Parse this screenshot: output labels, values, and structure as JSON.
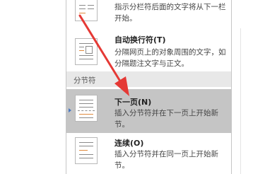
{
  "menu": {
    "items": [
      {
        "title": "",
        "desc": "指示分栏符后面的文字将从下一栏开始。",
        "icon": "column-break-icon"
      },
      {
        "title": "自动换行符(T)",
        "desc": "分隔网页上的对象周围的文字，如分隔题注文字与正文。",
        "icon": "text-wrapping-break-icon"
      },
      {
        "title": "下一页(N)",
        "desc": "插入分节符并在下一页上开始新节。",
        "icon": "next-page-section-break-icon"
      },
      {
        "title": "连续(O)",
        "desc": "插入分节符并在同一页上开始新节。",
        "icon": "continuous-section-break-icon"
      }
    ],
    "section_label": "分节符"
  },
  "colors": {
    "accent_arrow": "#e53935",
    "selected_bg": "#c5c5c5"
  }
}
